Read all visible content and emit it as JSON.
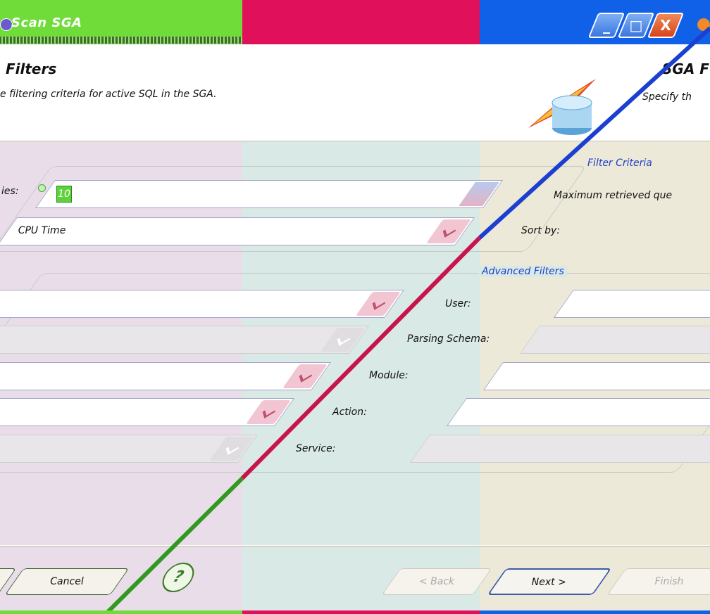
{
  "window": {
    "title": "Scan SGA",
    "buttons": {
      "minimize": "_",
      "maximize": "□",
      "close": "X"
    }
  },
  "header": {
    "title": "Filters",
    "description": "e filtering criteria for active SQL in the SGA.",
    "title_right": "SGA F",
    "description_right": "Specify th"
  },
  "filter_criteria": {
    "legend": "Filter Criteria",
    "max_queries_label": "Maximum retrieved que",
    "max_queries_label_left": "ies:",
    "max_queries_value": "10",
    "sort_by_label": "Sort by:",
    "sort_by_value": "CPU Time"
  },
  "advanced_filters": {
    "legend": "Advanced Filters",
    "user_label": "User:",
    "parsing_schema_label": "Parsing Schema:",
    "module_label": "Module:",
    "action_label": "Action:",
    "service_label": "Service:"
  },
  "footer": {
    "cancel_label": "Cancel",
    "back_label": "< Back",
    "next_label": "Next >",
    "finish_label": "Finish",
    "help_glyph": "?"
  },
  "colors": {
    "band_green": "#6fdc3a",
    "band_pink": "#e0105a",
    "band_blue": "#1060e8",
    "legend_blue": "#2040c8"
  }
}
